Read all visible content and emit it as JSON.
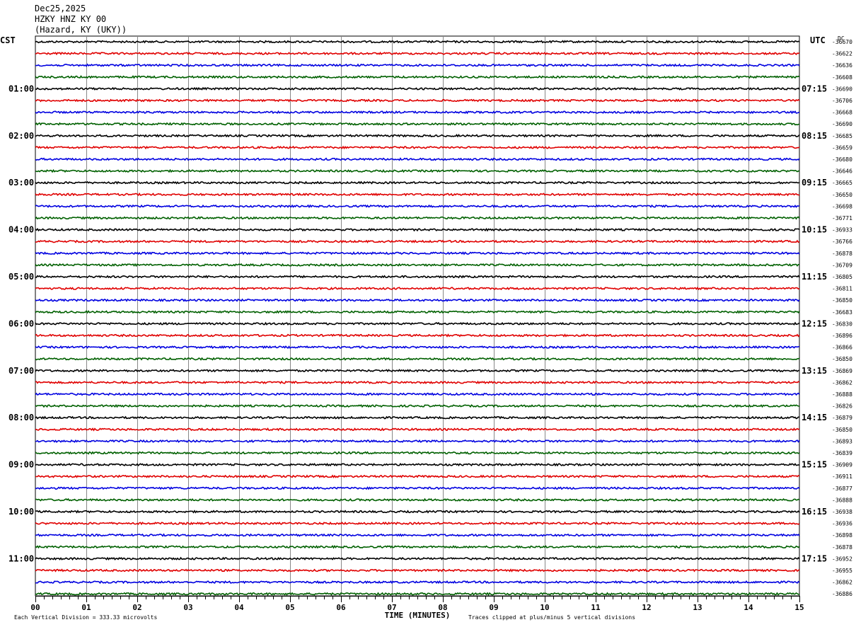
{
  "header": {
    "date": "Dec25,2025",
    "station": "HZKY HNZ KY 00",
    "location": "(Hazard, KY (UKY))"
  },
  "chart_data": {
    "type": "line",
    "subtype": "helicorder",
    "left_axis_label": "CST",
    "right_axis_label": "UTC",
    "dc_label": "DC",
    "minutes_per_line": 15,
    "line_count": 48,
    "line_colors": [
      "#000000",
      "#e00000",
      "#0000e0",
      "#006000"
    ],
    "grid": true,
    "left_time_labels": [
      "01:00",
      "02:00",
      "03:00",
      "04:00",
      "05:00",
      "06:00",
      "07:00",
      "08:00",
      "09:00",
      "10:00",
      "11:00"
    ],
    "right_time_labels": [
      "07:15",
      "08:15",
      "09:15",
      "10:15",
      "11:15",
      "12:15",
      "13:15",
      "14:15",
      "15:15",
      "16:15",
      "17:15"
    ],
    "dc_offsets": [
      "-36670",
      "-36622",
      "-36636",
      "-36608",
      "-36690",
      "-36706",
      "-36668",
      "-36690",
      "-36685",
      "-36659",
      "-36680",
      "-36646",
      "-36665",
      "-36650",
      "-36698",
      "-36771",
      "-36933",
      "-36766",
      "-36878",
      "-36709",
      "-36805",
      "-36811",
      "-36850",
      "-36683",
      "-36830",
      "-36896",
      "-36866",
      "-36850",
      "-36869",
      "-36862",
      "-36888",
      "-36826",
      "-36879",
      "-36850",
      "-36893",
      "-36839",
      "-36909",
      "-36911",
      "-36877",
      "-36888",
      "-36938",
      "-36936",
      "-36898",
      "-36878",
      "-36952",
      "-36955",
      "-36862",
      "-36886"
    ],
    "x": [
      "00",
      "01",
      "02",
      "03",
      "04",
      "05",
      "06",
      "07",
      "08",
      "09",
      "10",
      "11",
      "12",
      "13",
      "14",
      "15"
    ],
    "xlabel": "TIME (MINUTES)",
    "xlim": [
      0,
      15
    ]
  },
  "footer": {
    "scale_note": "Each Vertical Division =  333.33 microvolts",
    "clip_note": "Traces clipped at plus/minus 5 vertical divisions"
  }
}
